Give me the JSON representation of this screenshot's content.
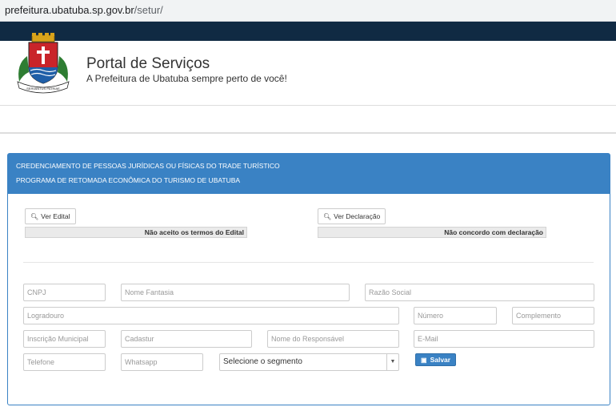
{
  "browser": {
    "url_host": "prefeitura.ubatuba.sp.gov.br",
    "url_path": "/setur/"
  },
  "header": {
    "title": "Portal de Serviços",
    "subtitle": "A Prefeitura de Ubatuba sempre perto de você!",
    "logo_ribbon": "SERVANTUS PATRIAE",
    "logo_seal_text": "UBATUBA"
  },
  "panel": {
    "heading_line1": "CREDENCIAMENTO DE PESSOAS JURÍDICAS OU FÍSICAS DO TRADE TURÍSTICO",
    "heading_line2": "PROGRAMA DE RETOMADA ECONÔMICA DO TURISMO DE UBATUBA",
    "accent_color": "#3a82c4"
  },
  "actions": {
    "ver_edital": "Ver Edital",
    "edital_toggle": "Não aceito os termos do Edital",
    "ver_declaracao": "Ver Declaração",
    "declaracao_toggle": "Não concordo com declaração",
    "salvar": "Salvar",
    "icon_search": "search-icon",
    "icon_save": "floppy-disk-icon"
  },
  "form": {
    "cnpj": "CNPJ",
    "nome_fantasia": "Nome Fantasia",
    "razao_social": "Razão Social",
    "logradouro": "Logradouro",
    "numero": "Número",
    "complemento": "Complemento",
    "inscricao_municipal": "Inscrição Municipal",
    "cadastur": "Cadastur",
    "nome_responsavel": "Nome do Responsável",
    "email": "E-Mail",
    "telefone": "Telefone",
    "whatsapp": "Whatsapp",
    "segmento_selected": "Selecione o segmento"
  }
}
